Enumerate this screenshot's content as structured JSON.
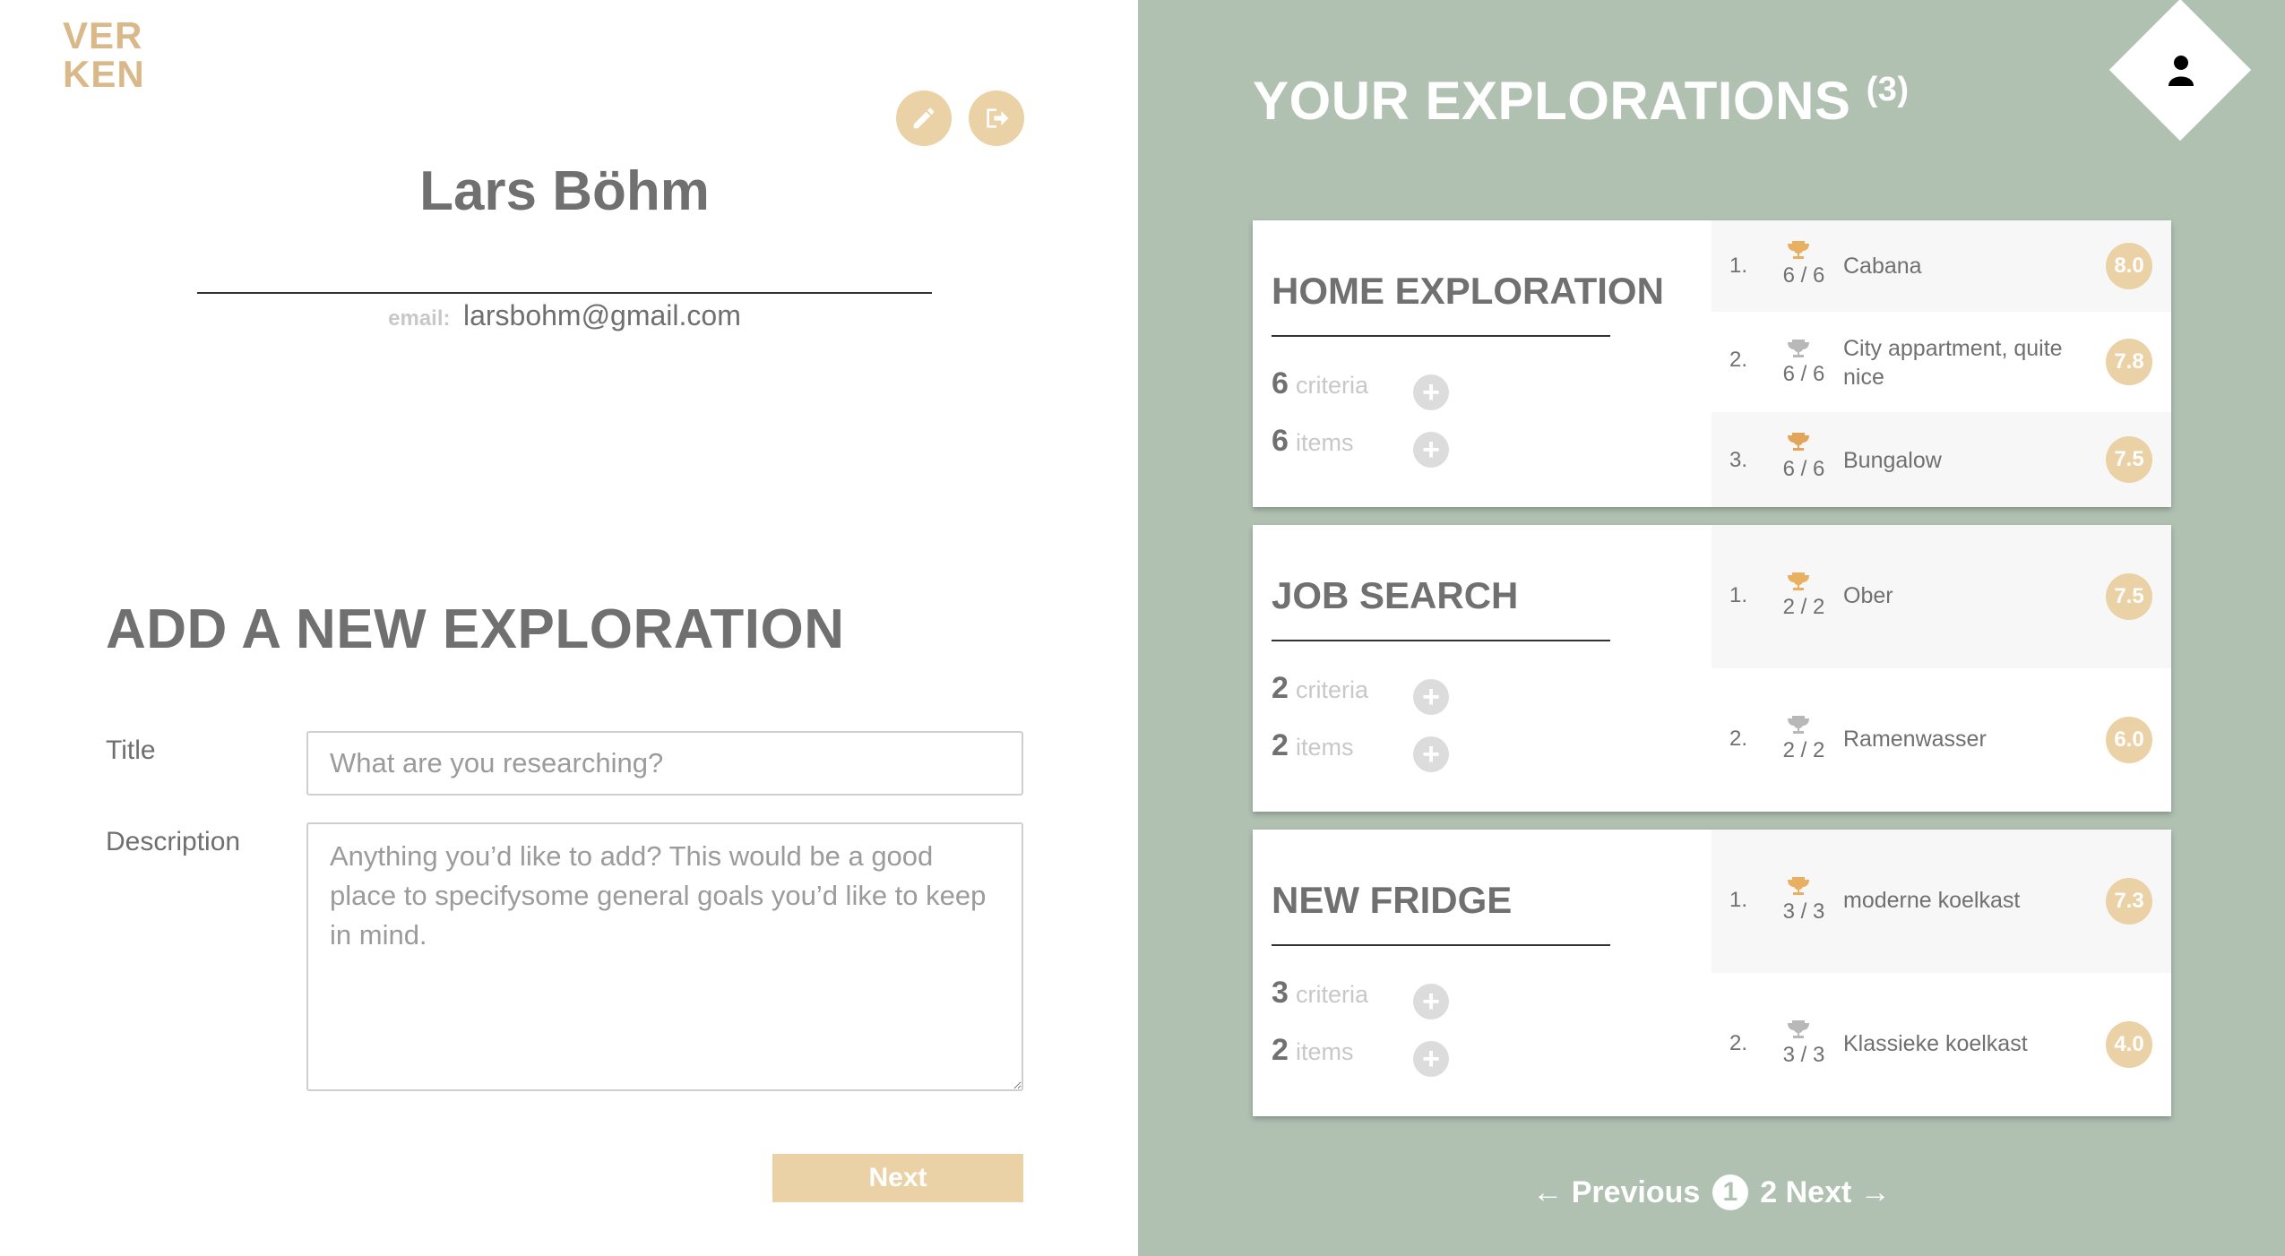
{
  "brand": {
    "logo_line1": "VER",
    "logo_line2": "KEN"
  },
  "profile": {
    "name": "Lars Böhm",
    "email_label": "email:",
    "email": "larsbohm@gmail.com"
  },
  "add_form": {
    "title": "ADD A NEW EXPLORATION",
    "title_label": "Title",
    "title_placeholder": "What are you researching?",
    "description_label": "Description",
    "description_placeholder": "Anything you’d like to add? This would be a good place to specifysome general goals you’d like to keep in mind.",
    "next_label": "Next"
  },
  "explorations": {
    "heading": "YOUR EXPLORATIONS",
    "count": "(3)",
    "cards": [
      {
        "title": "HOME EXPLORATION",
        "criteria_count": "6",
        "criteria_label": "criteria",
        "items_count": "6",
        "items_label": "items",
        "ranking": [
          {
            "rank": "1.",
            "score": "6 / 6",
            "name": "Cabana",
            "rating": "8.0"
          },
          {
            "rank": "2.",
            "score": "6 / 6",
            "name": "City appartment, quite nice",
            "rating": "7.8"
          },
          {
            "rank": "3.",
            "score": "6 / 6",
            "name": "Bungalow",
            "rating": "7.5"
          }
        ]
      },
      {
        "title": "JOB SEARCH",
        "criteria_count": "2",
        "criteria_label": "criteria",
        "items_count": "2",
        "items_label": "items",
        "ranking": [
          {
            "rank": "1.",
            "score": "2 / 2",
            "name": "Ober",
            "rating": "7.5"
          },
          {
            "rank": "2.",
            "score": "2 / 2",
            "name": "Ramenwasser",
            "rating": "6.0"
          }
        ]
      },
      {
        "title": "NEW FRIDGE",
        "criteria_count": "3",
        "criteria_label": "criteria",
        "items_count": "2",
        "items_label": "items",
        "ranking": [
          {
            "rank": "1.",
            "score": "3 / 3",
            "name": "moderne koelkast",
            "rating": "7.3"
          },
          {
            "rank": "2.",
            "score": "3 / 3",
            "name": "Klassieke koelkast",
            "rating": "4.0"
          }
        ]
      }
    ]
  },
  "pagination": {
    "previous": "← Previous",
    "page1": "1",
    "page2": "2",
    "next": "Next →"
  },
  "colors": {
    "accent": "#ead2a6",
    "panel": "#b0c1b2",
    "trophy_gold": "#e8b060",
    "trophy_silver": "#b8b8b8",
    "trophy_bronze": "#e3a55a"
  }
}
